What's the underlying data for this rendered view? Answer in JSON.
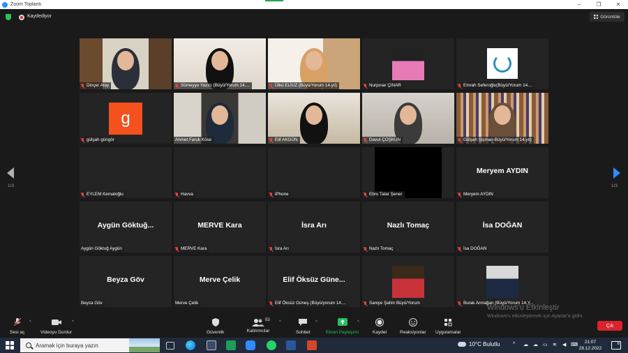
{
  "window": {
    "title": "Zoom Toplantı"
  },
  "status": {
    "recording": "Kaydediyor",
    "view_button": "Görüntüle"
  },
  "pagination": {
    "left": "1/3",
    "right": "1/3"
  },
  "tiles": [
    {
      "name": "Dinçer Atay",
      "big": "",
      "mic_off": true,
      "kind": "video"
    },
    {
      "name": "Sümeyye Yazıcı (Büyü/Yorum 14....",
      "big": "",
      "mic_off": true,
      "kind": "video"
    },
    {
      "name": "Ülkü ELİUZ (Büyü/Yorum 14.yıl)",
      "big": "",
      "mic_off": true,
      "kind": "video"
    },
    {
      "name": "Nurpınar ÇINAR",
      "big": "",
      "mic_off": true,
      "kind": "thumb"
    },
    {
      "name": "Emrah Seferoğlu(Büyü/Yorum 14....",
      "big": "",
      "mic_off": true,
      "kind": "emblem"
    },
    {
      "name": "gülşah güngör",
      "big": "",
      "mic_off": true,
      "kind": "avatar",
      "avatar_letter": "g"
    },
    {
      "name": "Ahmet Faruk Köse",
      "big": "",
      "mic_off": false,
      "kind": "video",
      "active": true
    },
    {
      "name": "Elif AKGÜN",
      "big": "",
      "mic_off": true,
      "kind": "video"
    },
    {
      "name": "Davut ÇOŞKUN",
      "big": "",
      "mic_off": true,
      "kind": "video"
    },
    {
      "name": "Gülşah Şişman-Büyü/Yorum 14.yıl)",
      "big": "",
      "mic_off": true,
      "kind": "video"
    },
    {
      "name": "EYLEM Kemaloğlu",
      "big": "",
      "mic_off": true,
      "kind": "name"
    },
    {
      "name": "Havva",
      "big": "",
      "mic_off": true,
      "kind": "name"
    },
    {
      "name": "iPhone",
      "big": "",
      "mic_off": true,
      "kind": "name"
    },
    {
      "name": "Ebru Tatar Şener",
      "big": "",
      "mic_off": true,
      "kind": "black"
    },
    {
      "name": "Meryem AYDIN",
      "big": "Meryem AYDIN",
      "mic_off": true,
      "kind": "name"
    },
    {
      "name": "Aygün Göktuğ Aygün",
      "big": "Aygün Göktuğ...",
      "mic_off": false,
      "kind": "name"
    },
    {
      "name": "MERVE Kara",
      "big": "MERVE Kara",
      "mic_off": true,
      "kind": "name"
    },
    {
      "name": "İsra Arı",
      "big": "İsra Arı",
      "mic_off": true,
      "kind": "name"
    },
    {
      "name": "Nazlı Tomaç",
      "big": "Nazlı Tomaç",
      "mic_off": true,
      "kind": "name"
    },
    {
      "name": "İsa DOĞAN",
      "big": "İsa DOĞAN",
      "mic_off": true,
      "kind": "name"
    },
    {
      "name": "Beyza Göv",
      "big": "Beyza Göv",
      "mic_off": false,
      "kind": "name"
    },
    {
      "name": "Merve Çelik",
      "big": "Merve Çelik",
      "mic_off": false,
      "kind": "name"
    },
    {
      "name": "Elif Öksüz Güneş (Büyü/yorum 14....",
      "big": "Elif Öksüz Güne...",
      "mic_off": true,
      "kind": "name"
    },
    {
      "name": "Saniye Şahin Büyü/Yorum",
      "big": "",
      "mic_off": true,
      "kind": "thumb"
    },
    {
      "name": "Burak Armağan (Büyü/Yorum 14.Y...",
      "big": "",
      "mic_off": true,
      "kind": "thumb"
    }
  ],
  "toolbar": {
    "audio": "Sesi aç",
    "video": "Videoyu Durdur",
    "security": "Güvenlik",
    "participants": "Katılımcılar",
    "participants_count": "53",
    "chat": "Sohbet",
    "share": "Ekran Paylaşımı",
    "record": "Kaydet",
    "reactions": "Reaksiyonlar",
    "apps": "Uygulamalar",
    "exit": "Çık"
  },
  "watermark": {
    "line1": "Windows'u Etkinleştir",
    "line2": "Windows'u etkinleştirmek için Ayarlar'a gidin."
  },
  "taskbar": {
    "search_placeholder": "Aramak için buraya yazın",
    "weather": "10°C Bulutlu",
    "time": "21:07",
    "date": "28.12.2022",
    "notifications": "6"
  },
  "colors": {
    "accent": "#2d8cff",
    "active_speaker": "#c8db3a",
    "exit": "#d9232d",
    "share": "#23c25e"
  }
}
